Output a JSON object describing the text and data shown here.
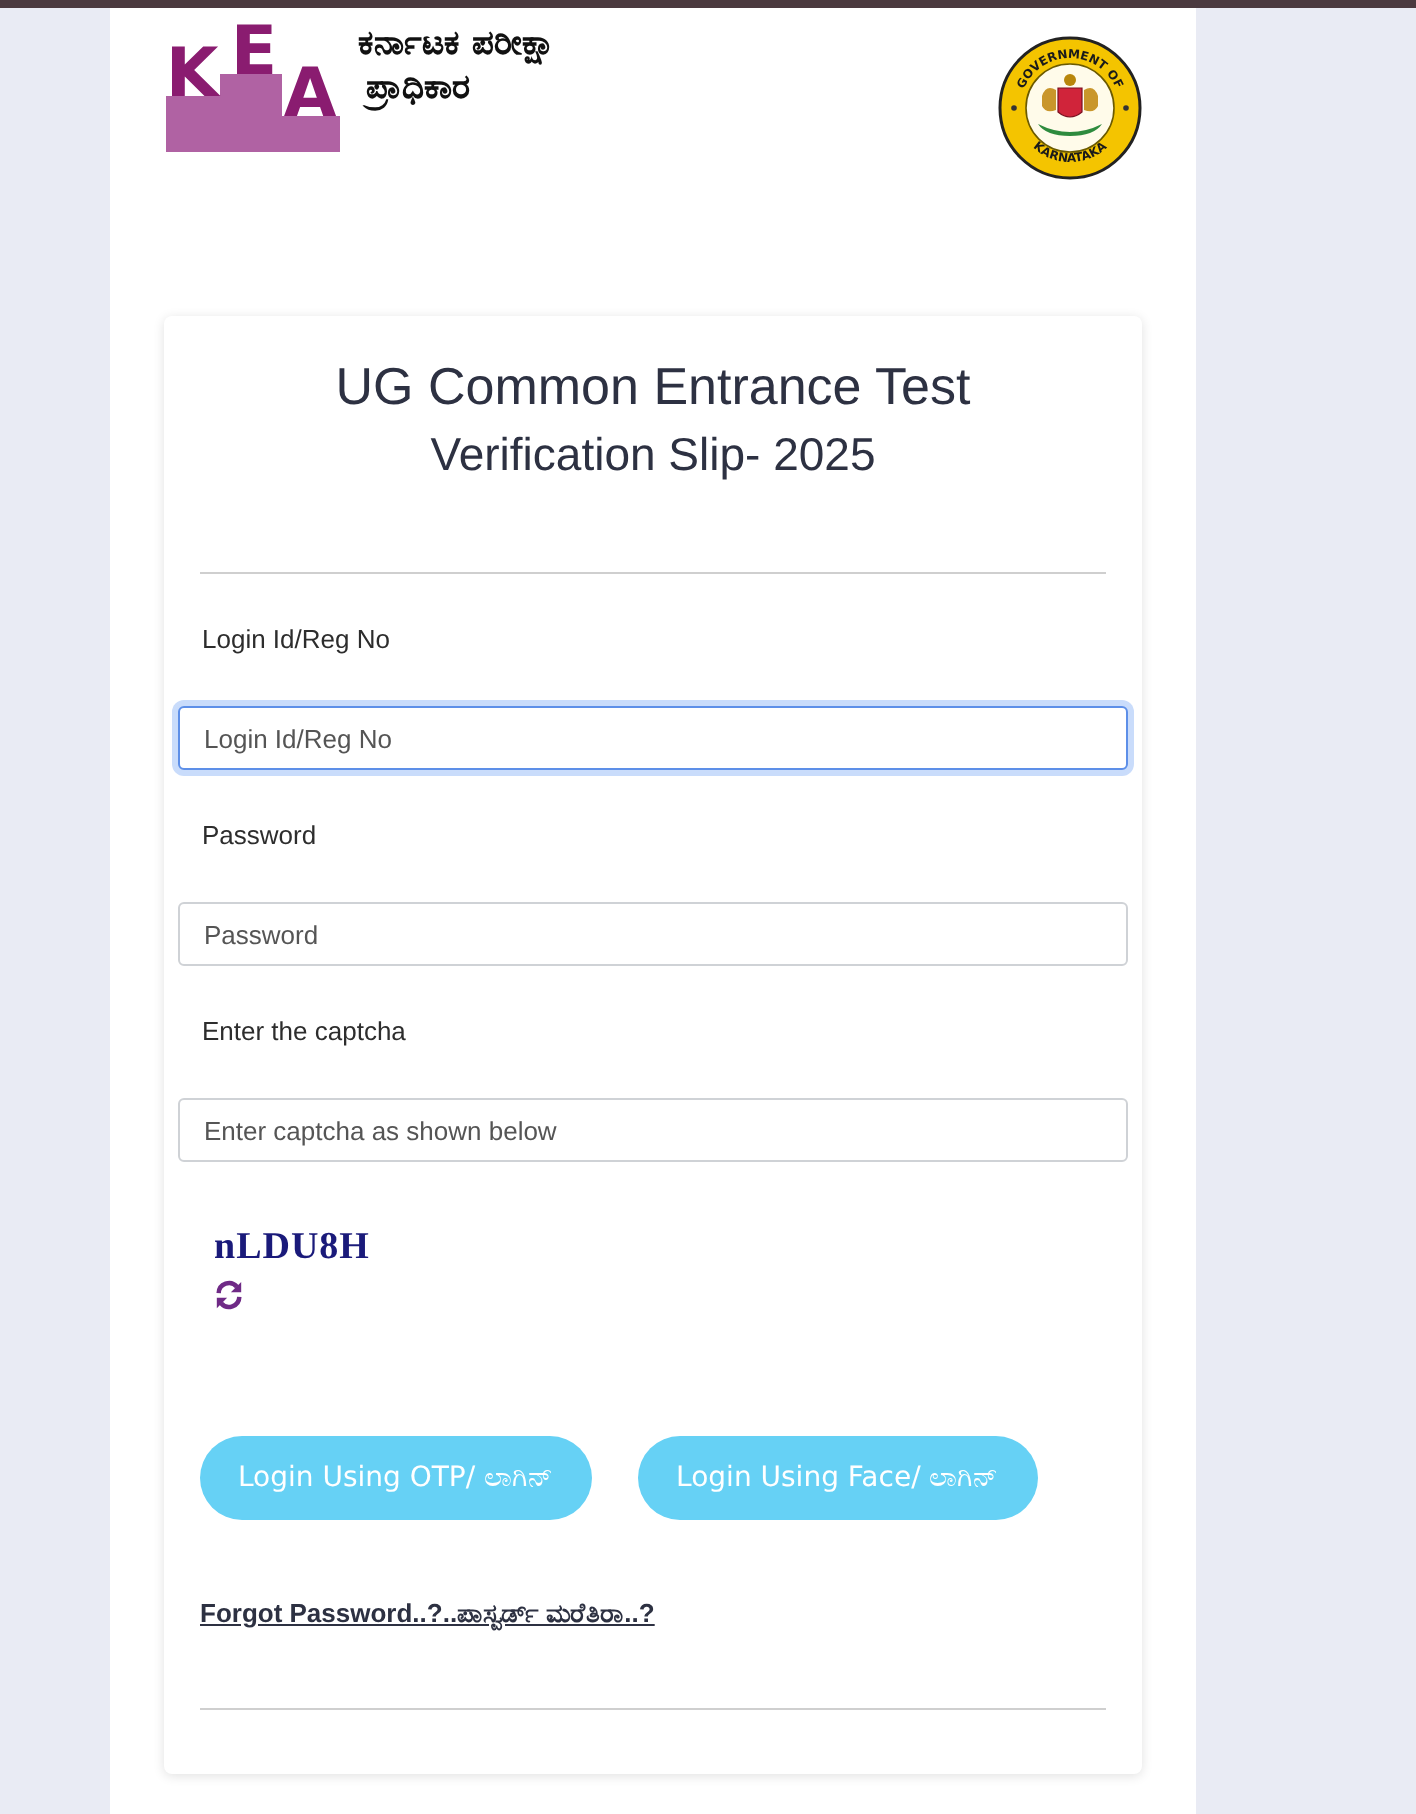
{
  "header": {
    "logo": {
      "letters": [
        "K",
        "E",
        "A"
      ]
    },
    "org_name": [
      "ಕರ್ನಾಟಕ ಪರೀಕ್ಷಾ",
      "ಪ್ರಾಧಿಕಾರ"
    ],
    "emblem": {
      "top_text": "GOVERNMENT OF",
      "bottom_text": "KARNATAKA"
    }
  },
  "card": {
    "title": "UG Common Entrance Test",
    "subtitle": "Verification Slip- 2025",
    "fields": [
      {
        "label": "Login Id/Reg No",
        "placeholder": "Login Id/Reg No",
        "focused": true
      },
      {
        "label": "Password",
        "placeholder": "Password",
        "focused": false
      },
      {
        "label": "Enter the captcha",
        "placeholder": "Enter captcha as shown below",
        "focused": false
      }
    ],
    "captcha": {
      "text": "nLDU8H"
    },
    "buttons": [
      "Login Using OTP/ ಲಾಗಿನ್",
      "Login Using Face/ ಲಾಗಿನ್"
    ],
    "forgot_link": "Forgot Password..?..ಪಾಸ್ವರ್ಡ್ ಮರೆತಿರಾ..?"
  }
}
